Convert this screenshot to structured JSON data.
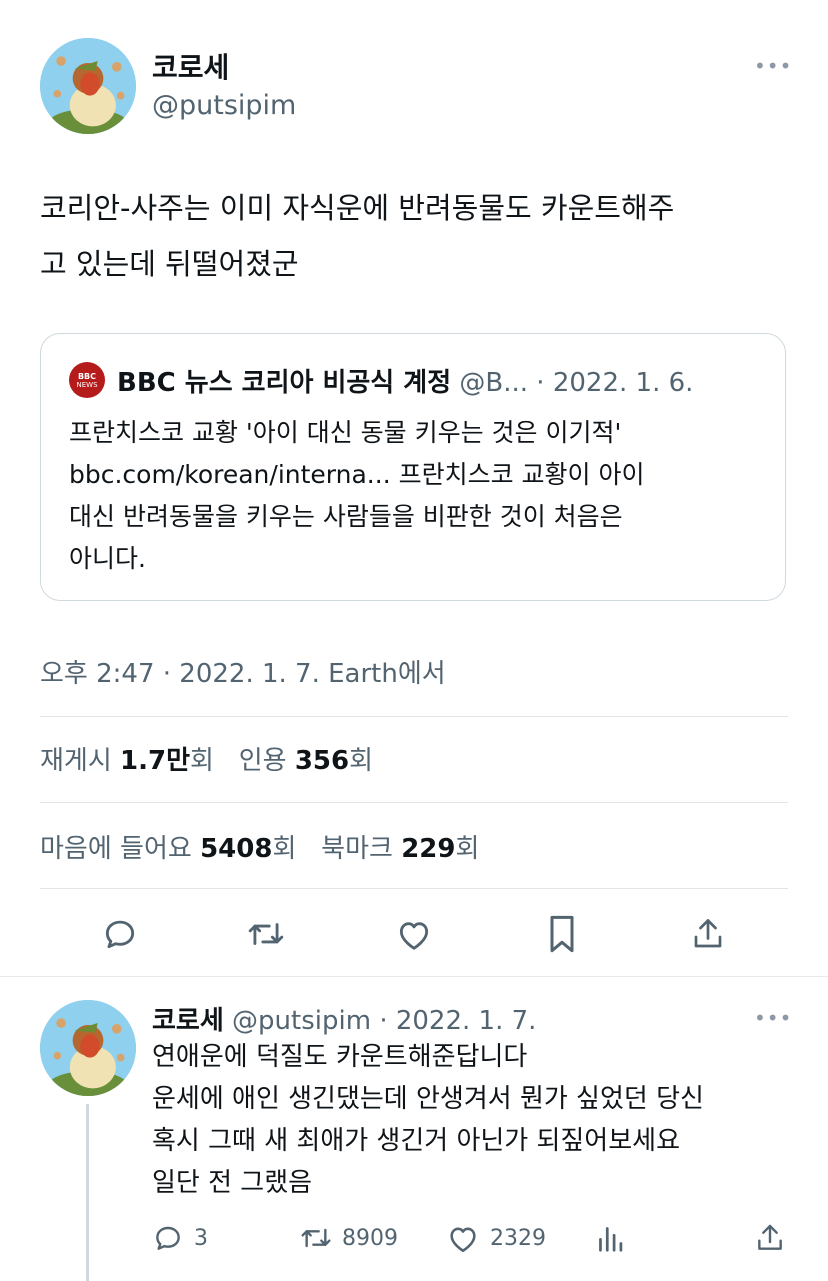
{
  "tweet": {
    "display_name": "코로세",
    "handle": "@putsipim",
    "text_lines": [
      "코리안-사주는 이미 자식운에 반려동물도 카운트해주",
      "고 있는데 뒤떨어졌군"
    ],
    "meta": "오후 2:47 · 2022. 1. 7. Earth에서"
  },
  "quote": {
    "source_name": "BBC 뉴스 코리아 비공식 계정",
    "handle": "@B...",
    "date": "· 2022. 1. 6.",
    "logo_text_top": "BBC",
    "logo_text_bottom": "NEWS",
    "text_lines": [
      "프란치스코 교황 '아이 대신 동물 키우는 것은 이기적'",
      "bbc.com/korean/interna... 프란치스코 교황이 아이",
      "대신 반려동물을 키우는 사람들을 비판한 것이 처음은",
      "아니다."
    ]
  },
  "stats": {
    "retweets_label": "재게시",
    "retweets_value": "1.7만",
    "quotes_label": "인용",
    "quotes_value": "356",
    "likes_label": "마음에 들어요",
    "likes_value": "5408",
    "bookmarks_label": "북마크",
    "bookmarks_value": "229",
    "unit": "회"
  },
  "reply": {
    "display_name": "코로세",
    "handle": "@putsipim",
    "date": "· 2022. 1. 7.",
    "text_lines": [
      "연애운에 덕질도 카운트해준답니다",
      "운세에 애인 생긴댔는데 안생겨서 뭔가 싶었던 당신",
      "혹시 그때 새 최애가 생긴거 아닌가 되짚어보세요",
      "일단 전 그랬음"
    ],
    "reply_count": "3",
    "retweet_count": "8909",
    "like_count": "2329"
  },
  "more_label": "•••",
  "icons": [
    "reply-icon",
    "retweet-icon",
    "like-icon",
    "bookmark-icon",
    "share-icon",
    "views-icon"
  ]
}
